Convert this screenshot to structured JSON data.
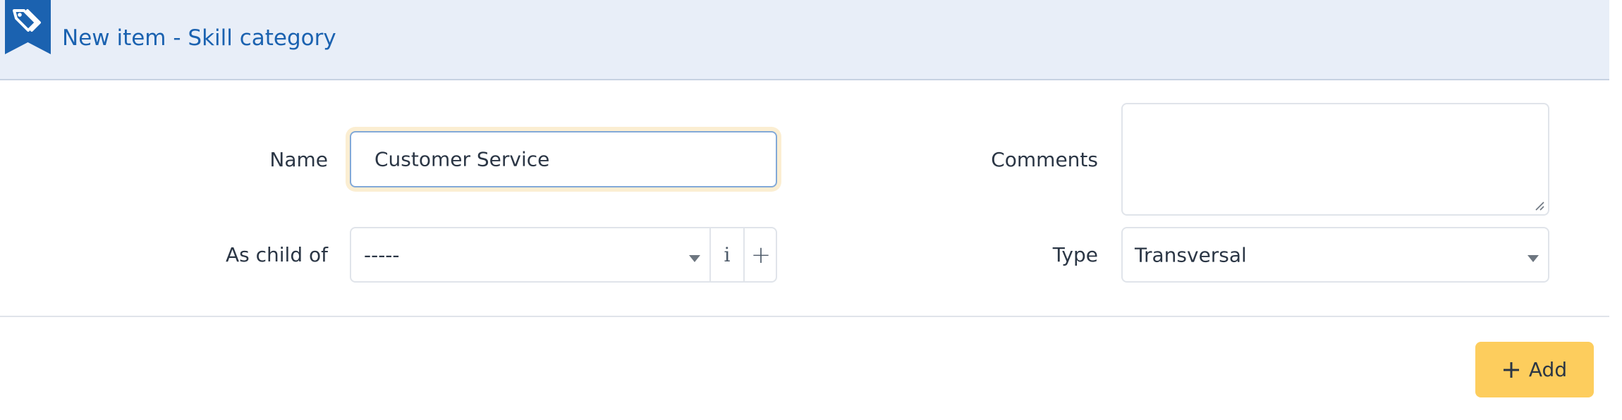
{
  "header": {
    "title": "New item - Skill category",
    "icon": "tags-icon",
    "accent_color": "#1b62b0"
  },
  "form": {
    "name": {
      "label": "Name",
      "value": "Customer Service"
    },
    "parent": {
      "label": "As child of",
      "value": "-----",
      "info_glyph": "i",
      "add_glyph": "+"
    },
    "comments": {
      "label": "Comments",
      "value": ""
    },
    "type": {
      "label": "Type",
      "value": "Transversal"
    }
  },
  "actions": {
    "add_label": "Add",
    "add_color": "#fdcd5d"
  }
}
